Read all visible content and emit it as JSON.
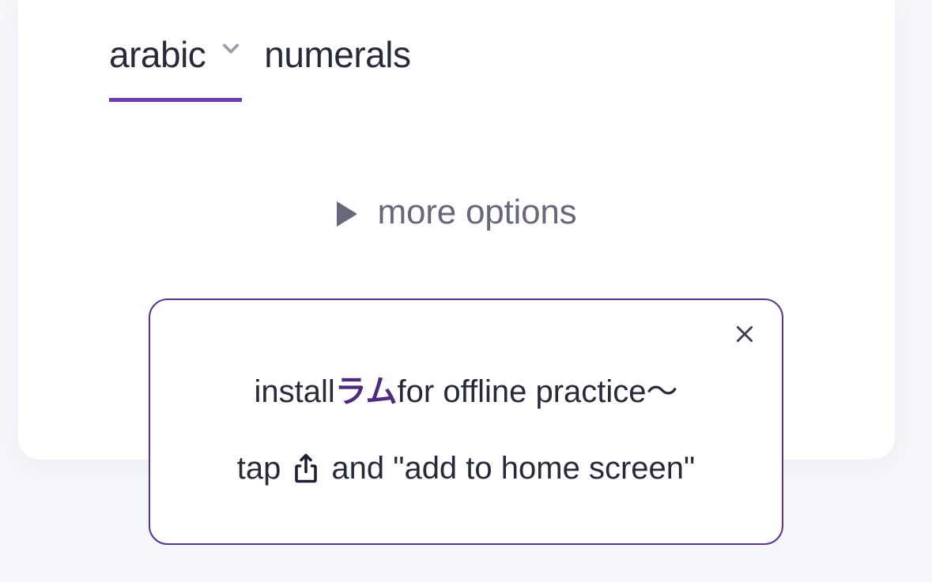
{
  "dropdown": {
    "value": "arabic",
    "suffix": "numerals"
  },
  "more_options": {
    "label": "more options"
  },
  "install_popup": {
    "prefix": "install ",
    "app_name": "ラム",
    "suffix": " for offline practice〜",
    "tap_prefix": "tap ",
    "tap_suffix": " and \"add to home screen\""
  }
}
